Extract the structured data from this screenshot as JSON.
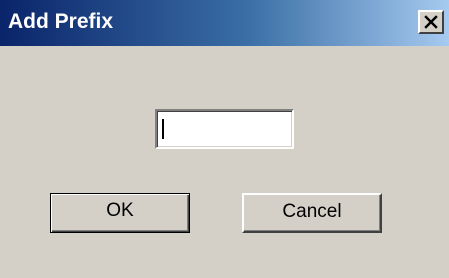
{
  "window": {
    "title": "Add Prefix",
    "close_icon": "close-icon"
  },
  "prefix_input": {
    "value": "",
    "placeholder": ""
  },
  "buttons": {
    "ok_label": "OK",
    "cancel_label": "Cancel"
  },
  "colors": {
    "dialog_background": "#d4d0c8",
    "titlebar_start": "#0a246a",
    "titlebar_end": "#a6caf0",
    "title_text": "#ffffff"
  }
}
